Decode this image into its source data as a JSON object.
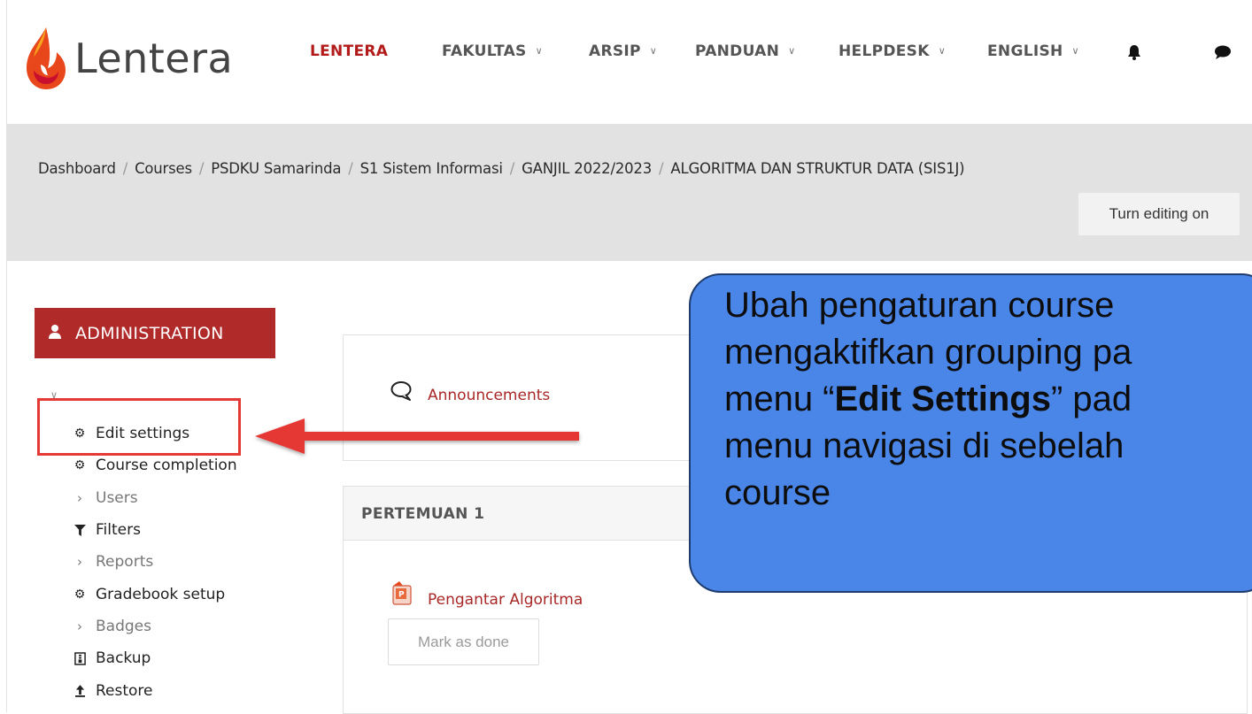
{
  "brand": {
    "logo_text": "Lentera",
    "accent": "#b02a2a",
    "flame_colors": [
      "#f7a41c",
      "#e8461b",
      "#c8102e"
    ]
  },
  "navbar": {
    "items": [
      {
        "label": "LENTERA",
        "active": true,
        "dropdown": false
      },
      {
        "label": "FAKULTAS",
        "dropdown": true
      },
      {
        "label": "ARSIP",
        "dropdown": true
      },
      {
        "label": "PANDUAN",
        "dropdown": true
      },
      {
        "label": "HELPDESK",
        "dropdown": true
      },
      {
        "label": "ENGLISH",
        "dropdown": true
      }
    ],
    "icons": [
      "bell-icon",
      "chat-icon"
    ]
  },
  "breadcrumb": [
    "Dashboard",
    "Courses",
    "PSDKU Samarinda",
    "S1 Sistem Informasi",
    "GANJIL 2022/2023",
    "ALGORITMA DAN STRUKTUR DATA (SIS1J)"
  ],
  "header": {
    "edit_button": "Turn editing on"
  },
  "administration": {
    "title": "ADMINISTRATION",
    "items": [
      {
        "label": "Edit settings",
        "icon": "gear-icon",
        "muted": false
      },
      {
        "label": "Course completion",
        "icon": "gear-icon",
        "muted": false
      },
      {
        "label": "Users",
        "icon": "chevron-right-icon",
        "muted": true
      },
      {
        "label": "Filters",
        "icon": "filter-icon",
        "muted": false
      },
      {
        "label": "Reports",
        "icon": "chevron-right-icon",
        "muted": true
      },
      {
        "label": "Gradebook setup",
        "icon": "gear-icon",
        "muted": false
      },
      {
        "label": "Badges",
        "icon": "chevron-right-icon",
        "muted": true
      },
      {
        "label": "Backup",
        "icon": "archive-icon",
        "muted": false
      },
      {
        "label": "Restore",
        "icon": "upload-icon",
        "muted": false
      }
    ]
  },
  "content": {
    "announcements": "Announcements",
    "section_title": "PERTEMUAN 1",
    "resource": "Pengantar Algoritma",
    "mark_done": "Mark as done"
  },
  "callout": {
    "line1": "Ubah pengaturan course",
    "line2": "mengaktifkan grouping pa",
    "line3_pre": "menu “",
    "line3_bold": "Edit Settings",
    "line3_post": "” pad",
    "line4": "menu navigasi di sebelah",
    "line5": "course",
    "bg": "#4a86e8"
  }
}
